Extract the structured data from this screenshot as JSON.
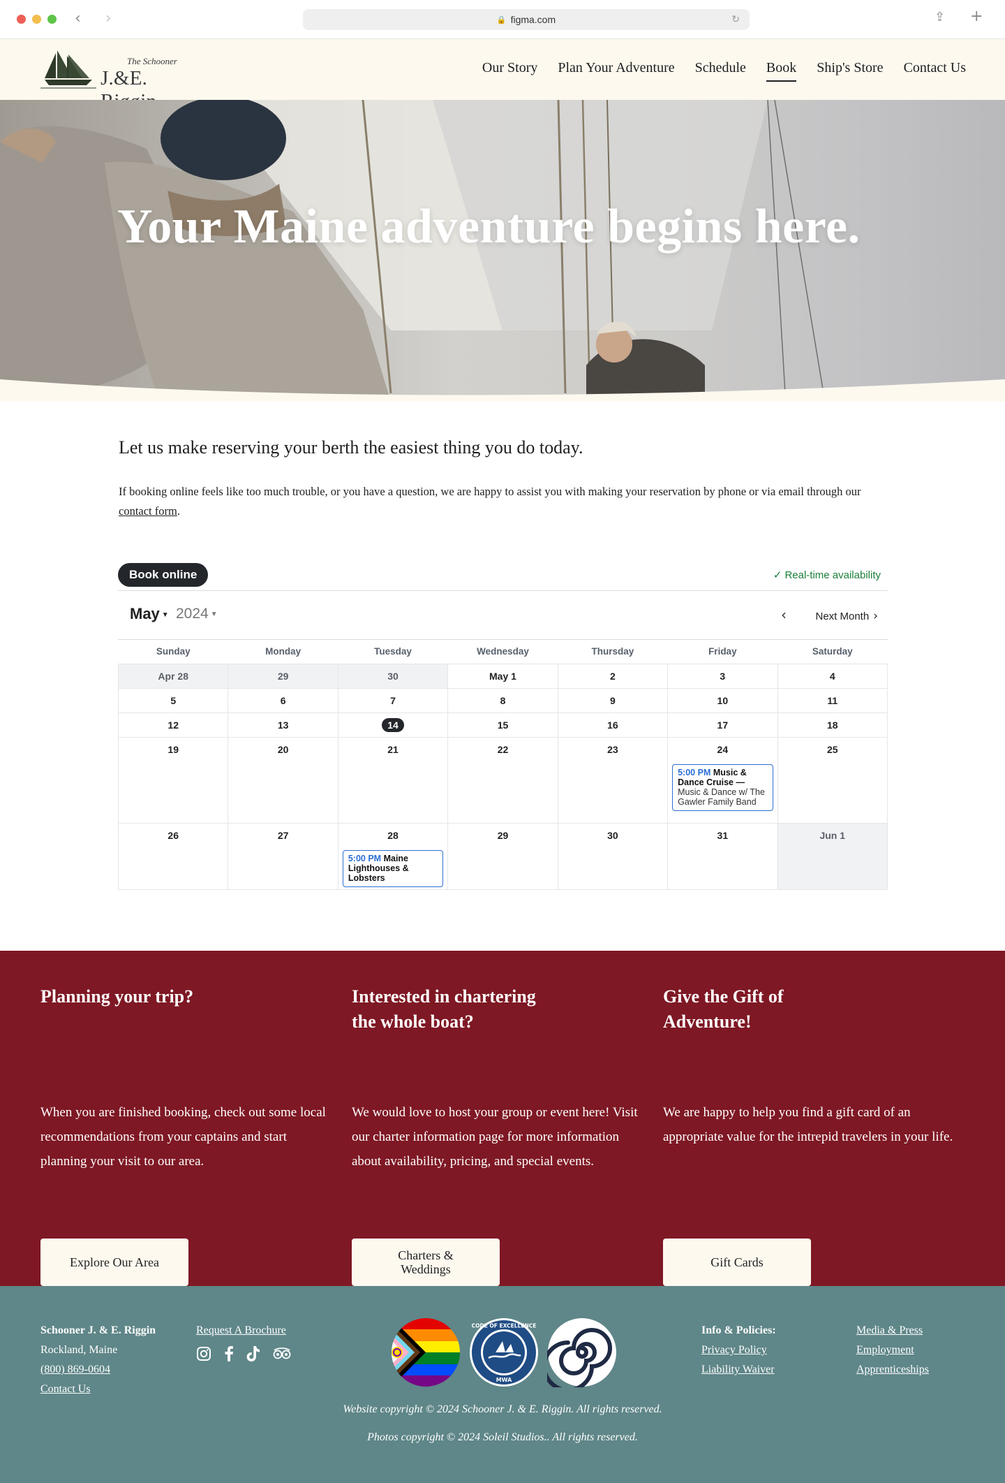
{
  "browser": {
    "url": "figma.com",
    "colors": {
      "close": "#ee5f57",
      "minimize": "#f4bd4f",
      "maximize": "#5ec448"
    }
  },
  "header": {
    "logo_sub": "The Schooner",
    "logo_main": "J.&E. Riggin",
    "nav": {
      "our_story": "Our Story",
      "plan": "Plan Your Adventure",
      "schedule": "Schedule",
      "book": "Book",
      "store": "Ship's Store",
      "contact": "Contact Us"
    }
  },
  "hero": {
    "title": "Your Maine adventure begins here."
  },
  "intro": {
    "heading": "Let us make reserving your berth the easiest thing you do today.",
    "body_before": "If booking online feels like too much trouble, or you have a question, we are happy to assist you with making your reservation by phone or via email through our ",
    "body_link": "contact form",
    "body_after": "."
  },
  "booking": {
    "pill": "Book online",
    "realtime": "✓ Real-time availability",
    "month": "May",
    "year": "2024",
    "next_label": "Next Month",
    "weekdays": [
      "Sunday",
      "Monday",
      "Tuesday",
      "Wednesday",
      "Thursday",
      "Friday",
      "Saturday"
    ],
    "weeks": [
      [
        "Apr 28",
        "29",
        "30",
        "May 1",
        "2",
        "3",
        "4"
      ],
      [
        "5",
        "6",
        "7",
        "8",
        "9",
        "10",
        "11"
      ],
      [
        "12",
        "13",
        "14",
        "15",
        "16",
        "17",
        "18"
      ],
      [
        "19",
        "20",
        "21",
        "22",
        "23",
        "24",
        "25"
      ],
      [
        "26",
        "27",
        "28",
        "29",
        "30",
        "31",
        "Jun 1"
      ]
    ],
    "events": {
      "e1_time": "5:00 PM",
      "e1_title": "Music & Dance Cruise —",
      "e1_desc": "Music & Dance w/ The Gawler Family Band",
      "e2_time": "5:00 PM",
      "e2_title": "Maine Lighthouses & Lobsters"
    }
  },
  "cta": {
    "col1": {
      "title": "Planning your trip?",
      "body": "When you are finished booking, check out some local recommendations from your captains and start planning your visit to our area.",
      "button": "Explore Our Area"
    },
    "col2": {
      "title_l1": "Interested in chartering",
      "title_l2": "the whole boat?",
      "body": "We would love to host your group or event here! Visit our charter information page for more information about availability, pricing, and special events.",
      "button_l1": "Charters &",
      "button_l2": "Weddings"
    },
    "col3": {
      "title_l1": "Give the Gift of",
      "title_l2": "Adventure!",
      "body": "We are happy to help you find a gift card of an appropriate value for the intrepid travelers in your life.",
      "button": "Gift Cards"
    }
  },
  "footer": {
    "name": "Schooner J. & E. Riggin",
    "location": "Rockland, Maine",
    "phone": "(800) 869-0604",
    "contact": "Contact Us",
    "brochure": "Request A Brochure",
    "badge_mwa_top": "CODE OF EXCELLENCE",
    "badge_mwa_bottom": "MWA",
    "info_heading": "Info & Policies:",
    "privacy": "Privacy Policy",
    "waiver": "Liability Waiver",
    "media": "Media & Press",
    "employment": "Employment",
    "apprenticeships": "Apprenticeships",
    "copyright1": "Website copyright © 2024 Schooner J. & E. Riggin. All rights reserved.",
    "copyright2": "Photos copyright © 2024 Soleil Studios.. All rights reserved."
  },
  "theme": {
    "cream": "#fdf9ef",
    "maroon": "#7e1824",
    "teal": "#5f8688",
    "dark": "#23262b",
    "event_blue": "#2d6fd2",
    "green": "#1b7f3a"
  }
}
